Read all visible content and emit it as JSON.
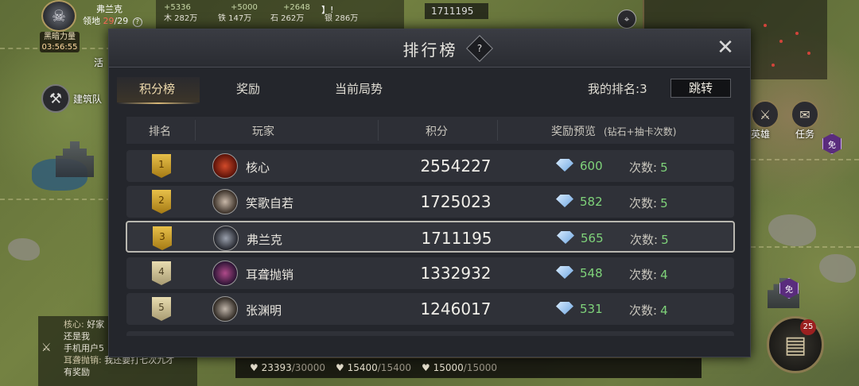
{
  "hud": {
    "lord_name": "弗兰克",
    "territory_label": "领地",
    "territory_count": "29",
    "territory_max": "/29",
    "dark_power_label": "黑暗力量",
    "dark_power_timer": "03:56:55",
    "resources": [
      {
        "gain": "+5336",
        "label": "木 282万"
      },
      {
        "gain": "+5000",
        "label": "铁 147万"
      },
      {
        "gain": "+2648",
        "label": "石 262万"
      },
      {
        "gain": "",
        "label": "银 286万"
      }
    ],
    "chat_top": "】!",
    "top_number": "1711195",
    "build_queue_label": "建筑队",
    "activity_label": "活",
    "hero_label": "英雄",
    "task_label": "任务",
    "book_badge": "25",
    "purple_badge": "免"
  },
  "chat": {
    "lines": [
      {
        "name": "核心:",
        "text": "好家"
      },
      {
        "name": "",
        "text": "还是我"
      },
      {
        "name": "",
        "text": "手机用户5"
      },
      {
        "name": "耳聋抛销:",
        "text": "我还要打七次九才"
      },
      {
        "name": "",
        "text": "有奖励"
      }
    ]
  },
  "stamina": [
    {
      "current": "23393",
      "max": "/30000"
    },
    {
      "current": "15400",
      "max": "/15400"
    },
    {
      "current": "15000",
      "max": "/15000"
    }
  ],
  "leaderboard": {
    "title": "排行榜",
    "help": "?",
    "close": "✕",
    "tabs": [
      "积分榜",
      "奖励",
      "当前局势"
    ],
    "my_rank_label": "我的排名:",
    "my_rank_value": "3",
    "jump_label": "跳转",
    "columns": {
      "rank": "排名",
      "player": "玩家",
      "score": "积分",
      "reward": "奖励预览",
      "reward_sub": "(钻石+抽卡次数)"
    },
    "draws_label": "次数:",
    "rows": [
      {
        "rank": "1",
        "name": "核心",
        "score": "2554227",
        "diamonds": "600",
        "draws": "5",
        "badge": "gold"
      },
      {
        "rank": "2",
        "name": "笑歌自若",
        "score": "1725023",
        "diamonds": "582",
        "draws": "5",
        "badge": "gold"
      },
      {
        "rank": "3",
        "name": "弗兰克",
        "score": "1711195",
        "diamonds": "565",
        "draws": "5",
        "badge": "gold"
      },
      {
        "rank": "4",
        "name": "耳聋抛销",
        "score": "1332932",
        "diamonds": "548",
        "draws": "4",
        "badge": "pale"
      },
      {
        "rank": "5",
        "name": "张渊明",
        "score": "1246017",
        "diamonds": "531",
        "draws": "4",
        "badge": "pale"
      }
    ]
  },
  "colors": {
    "accent_gold": "#d8b878",
    "value_green": "#7fd37a",
    "modal_bg": "#24262c",
    "territory_red": "#ff6b5a"
  }
}
